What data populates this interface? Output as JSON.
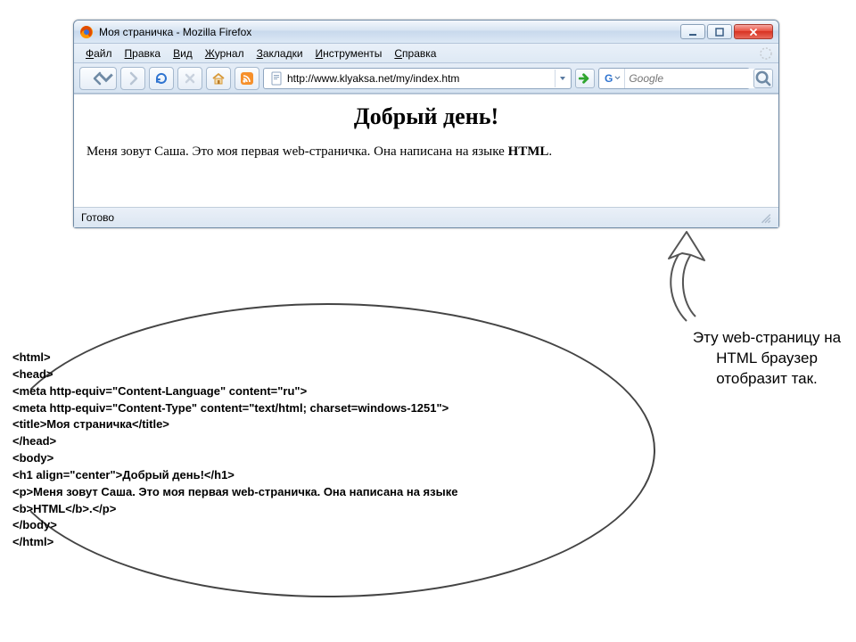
{
  "window": {
    "title": "Моя страничка - Mozilla Firefox"
  },
  "menu": {
    "items": [
      {
        "u": "Ф",
        "rest": "айл"
      },
      {
        "u": "П",
        "rest": "равка"
      },
      {
        "u": "В",
        "rest": "ид"
      },
      {
        "u": "Ж",
        "rest": "урнал"
      },
      {
        "u": "З",
        "rest": "акладки"
      },
      {
        "u": "И",
        "rest": "нструменты"
      },
      {
        "u": "С",
        "rest": "правка"
      }
    ]
  },
  "toolbar": {
    "url": "http://www.klyaksa.net/my/index.htm",
    "search_engine": "G",
    "search_placeholder": "Google"
  },
  "page": {
    "heading": "Добрый день!",
    "paragraph_plain": "Меня зовут Саша. Это моя первая web-страничка. Она написана на языке ",
    "paragraph_bold": "HTML",
    "paragraph_tail": "."
  },
  "status": {
    "text": "Готово"
  },
  "caption": "Эту web-страницу на HTML браузер отобразит так.",
  "source_code": "<html>\n<head>\n<meta http-equiv=\"Content-Language\" content=\"ru\">\n<meta http-equiv=\"Content-Type\" content=\"text/html; charset=windows-1251\">\n<title>Моя страничка</title>\n</head>\n<body>\n<h1 align=\"center\">Добрый день!</h1>\n<p>Меня зовут Саша. Это моя первая web-страничка. Она написана на языке <b>HTML</b>.</p>\n</body>\n</html>"
}
